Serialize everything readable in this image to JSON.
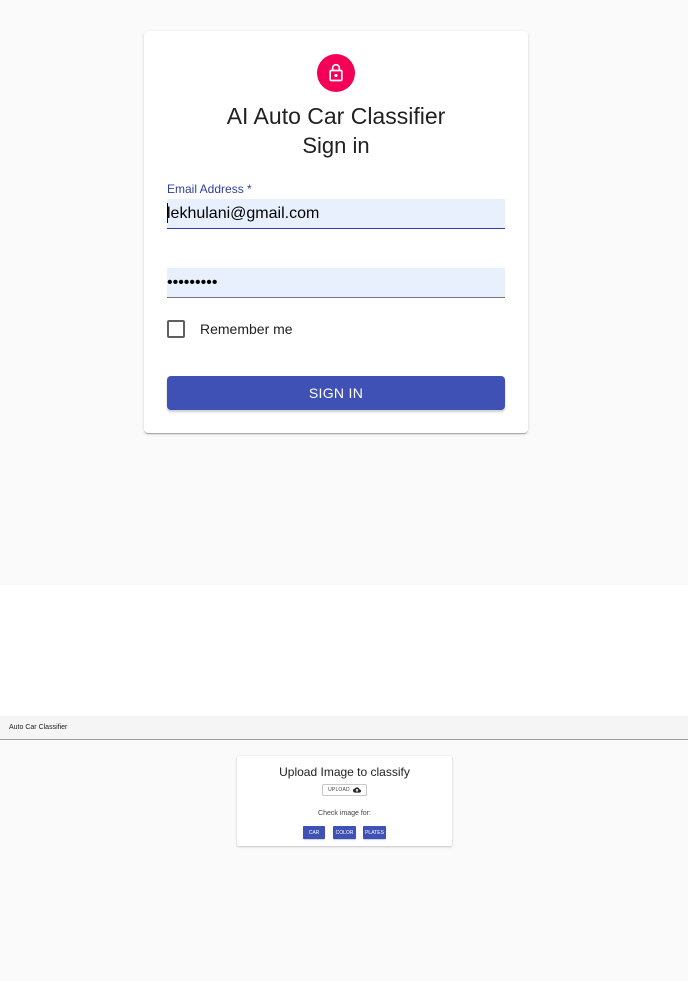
{
  "colors": {
    "primary": "#3f51b5",
    "lock_avatar": "#f50057",
    "label": "#303f9f",
    "autofill_bg": "#e8f0fe"
  },
  "signin": {
    "lock_icon": "lock-outline-icon",
    "app_title": "AI Auto Car Classifier",
    "page_title": "Sign in",
    "email_label": "Email Address *",
    "email_value": "lekhulani@gmail.com",
    "password_value": "•••••••••",
    "remember_label": "Remember me",
    "button_label": "SIGN IN"
  },
  "classifier": {
    "app_bar_title": "Auto Car Classifier",
    "upload_title": "Upload Image to classify",
    "upload_label": "UPLOAD",
    "upload_icon": "cloud-upload-icon",
    "check_label": "Check image for:",
    "buttons": [
      "CAR",
      "COLOR",
      "PLATES"
    ]
  }
}
